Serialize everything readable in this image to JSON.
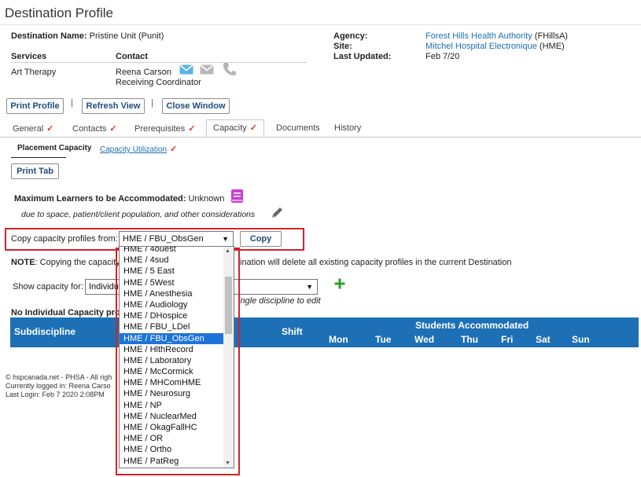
{
  "page": {
    "title": "Destination Profile"
  },
  "destination": {
    "name_label": "Destination Name:",
    "name_value": "Pristine Unit (Punit)",
    "agency_label": "Agency:",
    "agency_value": "Forest Hills Health Authority",
    "agency_abbr": "(FHillsA)",
    "site_label": "Site:",
    "site_value": "Mitchel Hospital Electronique",
    "site_abbr": "(HME)",
    "updated_label": "Last Updated:",
    "updated_value": "Feb 7/20"
  },
  "services": {
    "services_header": "Services",
    "contact_header": "Contact",
    "service": "Art Therapy",
    "contact_name": "Reena Carson",
    "contact_role": "Receiving Coordinator"
  },
  "toolbar": {
    "print_profile": "Print Profile",
    "refresh_view": "Refresh View",
    "close_window": "Close Window",
    "separator": "|"
  },
  "tabs": [
    {
      "label": "General",
      "checked": true
    },
    {
      "label": "Contacts",
      "checked": true
    },
    {
      "label": "Prerequisites",
      "checked": true
    },
    {
      "label": "Capacity",
      "checked": true
    },
    {
      "label": "Documents",
      "checked": false
    },
    {
      "label": "History",
      "checked": false
    }
  ],
  "check_glyph": "✓",
  "subtabs": {
    "placement": "Placement Capacity",
    "utilization": "Capacity Utilization"
  },
  "capacity": {
    "print_tab": "Print Tab",
    "max_label": "Maximum Learners to be Accommodated:",
    "max_value": "Unknown",
    "note_italic": "due to space, patient/client population, and other considerations",
    "copy_label": "Copy capacity profiles from:",
    "copy_selected": "HME / FBU_ObsGen",
    "copy_button": "Copy",
    "note_bold": "NOTE",
    "note_text_left": ": Copying the capacity",
    "note_text_right": "ination will delete all existing capacity profiles in the current Destination",
    "show_label": "Show capacity for:",
    "show_value": "Individu",
    "hint": "ingle discipline to edit",
    "no_individual": "No Individual Capacity pro"
  },
  "table": {
    "subdiscipline": "Subdiscipline",
    "shift": "Shift",
    "students": "Students Accommodated",
    "days": [
      "Mon",
      "Tue",
      "Wed",
      "Thu",
      "Fri",
      "Sat",
      "Sun"
    ]
  },
  "footer": {
    "line1": "© hspcanada.net - PHSA - All righ",
    "line2": "Currently logged in: Reena Carso",
    "line3": "Last Login: Feb  7 2020  2:08PM"
  },
  "dropdown": {
    "options": [
      "HME / 4ouest",
      "HME / 4sud",
      "HME / 5 East",
      "HME / 5West",
      "HME / Anesthesia",
      "HME / Audiology",
      "HME / DHospice",
      "HME / FBU_LDel",
      "HME / FBU_ObsGen",
      "HME / HlthRecord",
      "HME / Laboratory",
      "HME / McCormick",
      "HME / MHComHME",
      "HME / Neurosurg",
      "HME / NP",
      "HME / NuclearMed",
      "HME / OkagFallHC",
      "HME / OR",
      "HME / Ortho",
      "HME / PatReg"
    ],
    "selected_index": 8,
    "scroll_position": 0.14
  },
  "colors": {
    "accent": "#1e70b6",
    "highlight": "#d3222a",
    "check": "#e0302b",
    "book_icon": "#c93fd0",
    "add": "#2aa02a"
  }
}
